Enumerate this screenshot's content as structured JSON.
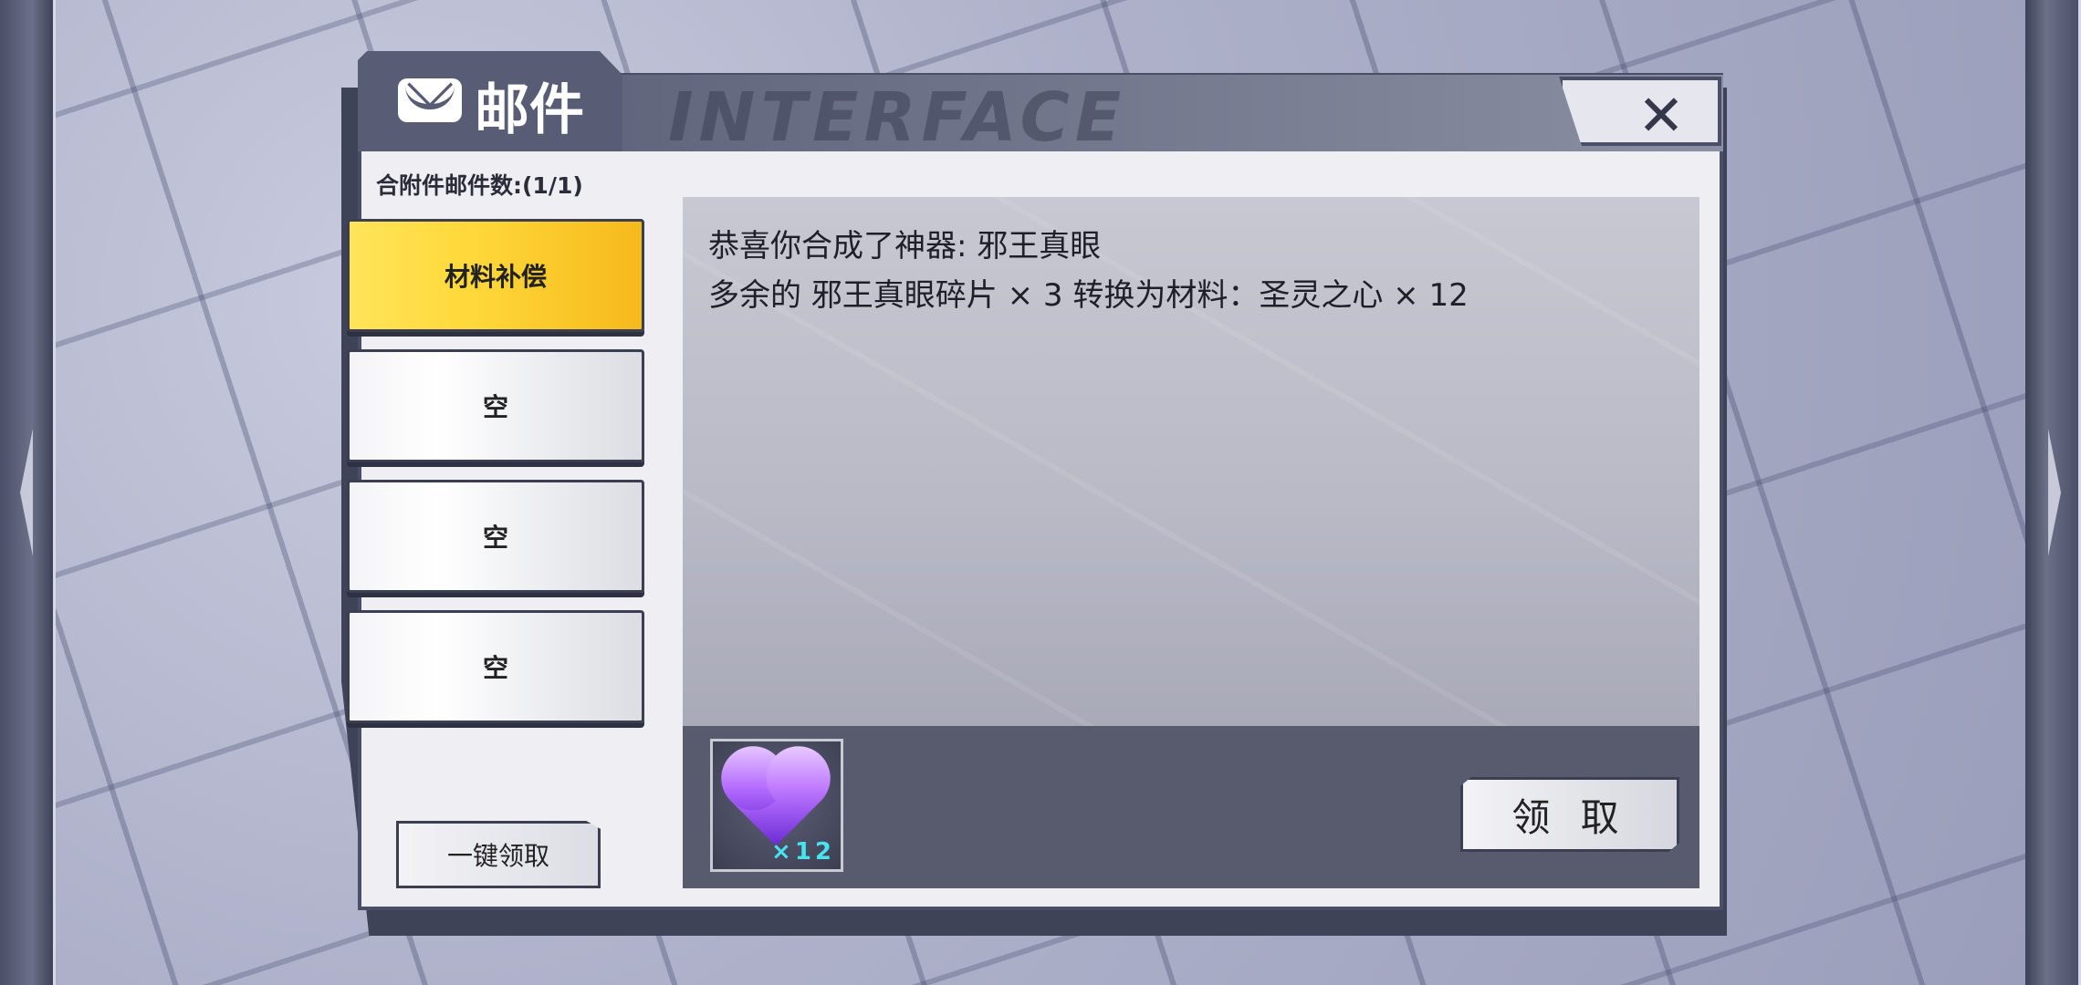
{
  "header": {
    "title": "邮件",
    "decoration": "INTERFACE"
  },
  "mail_count_label": "合附件邮件数:(1/1)",
  "mail_list": [
    {
      "label": "材料补偿",
      "active": true
    },
    {
      "label": "空",
      "active": false
    },
    {
      "label": "空",
      "active": false
    },
    {
      "label": "空",
      "active": false
    }
  ],
  "claim_all_label": "一键领取",
  "message": {
    "line1": "恭喜你合成了神器: 邪王真眼",
    "line2": "多余的 邪王真眼碎片 × 3 转换为材料：圣灵之心 × 12"
  },
  "attachment": {
    "icon": "heart-gem-icon",
    "quantity": "×12"
  },
  "claim_label": "领 取",
  "close_icon": "close-icon",
  "colors": {
    "active_tab": "#ffd93b",
    "header": "#585c74",
    "qty_text": "#49e3f0"
  }
}
